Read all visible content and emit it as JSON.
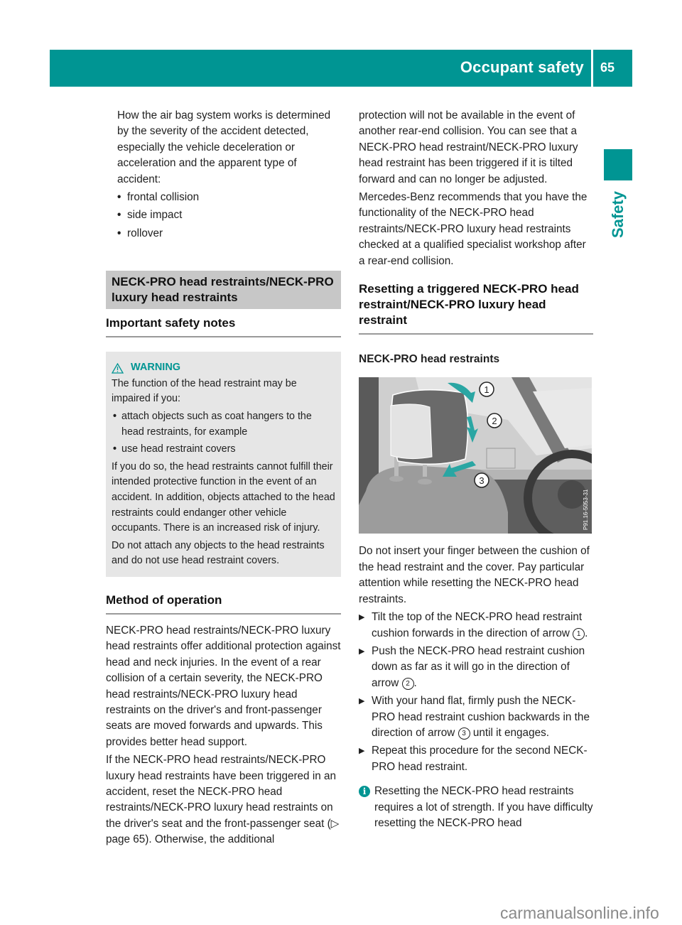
{
  "header": {
    "title": "Occupant safety",
    "page_number": "65",
    "accent_color": "#009593"
  },
  "sidebar": {
    "section_label": "Safety"
  },
  "left_column": {
    "intro": "How the air bag system works is determined by the severity of the accident detected, especially the vehicle deceleration or acceleration and the apparent type of accident:",
    "accident_types": [
      "frontal collision",
      "side impact",
      "rollover"
    ],
    "section_heading": "NECK-PRO head restraints/NECK-PRO luxury head restraints",
    "subsection_heading": "Important safety notes",
    "warning": {
      "label": "WARNING",
      "intro": "The function of the head restraint may be impaired if you:",
      "bullets": [
        "attach objects such as coat hangers to the head restraints, for example",
        "use head restraint covers"
      ],
      "consequence": "If you do so, the head restraints cannot fulfill their intended protective function in the event of an accident. In addition, objects attached to the head restraints could endanger other vehicle occupants. There is an increased risk of injury.",
      "instruction": "Do not attach any objects to the head restraints and do not use head restraint covers."
    },
    "method_heading": "Method of operation",
    "method_p1": "NECK-PRO head restraints/NECK-PRO luxury head restraints offer additional protection against head and neck injuries. In the event of a rear collision of a certain severity, the NECK-PRO head restraints/NECK-PRO luxury head restraints on the driver's and front-passenger seats are moved forwards and upwards. This provides better head support.",
    "method_p2": "If the NECK-PRO head restraints/NECK-PRO luxury head restraints have been triggered in an accident, reset the NECK-PRO head restraints/NECK-PRO luxury head restraints on the driver's seat and the front-passenger seat (▷ page 65). Otherwise, the additional"
  },
  "right_column": {
    "continuation": "protection will not be available in the event of another rear-end collision. You can see that a NECK-PRO head restraint/NECK-PRO luxury head restraint has been triggered if it is tilted forward and can no longer be adjusted.",
    "recommendation": "Mercedes-Benz recommends that you have the functionality of the NECK-PRO head restraints/NECK-PRO luxury head restraints checked at a qualified specialist workshop after a rear-end collision.",
    "reset_heading": "Resetting a triggered NECK-PRO head restraint/NECK-PRO luxury head restraint",
    "neckpro_heading": "NECK-PRO head restraints",
    "figure": {
      "callouts": [
        "1",
        "2",
        "3"
      ],
      "code": "P91.16-5053-31"
    },
    "caution": "Do not insert your finger between the cushion of the head restraint and the cover. Pay particular attention while resetting the NECK-PRO head restraints.",
    "steps": [
      {
        "before": "Tilt the top of the NECK-PRO head restraint cushion forwards in the direction of arrow ",
        "ref": "1",
        "after": "."
      },
      {
        "before": "Push the NECK-PRO head restraint cushion down as far as it will go in the direction of arrow ",
        "ref": "2",
        "after": "."
      },
      {
        "before": "With your hand flat, firmly push the NECK-PRO head restraint cushion backwards in the direction of arrow ",
        "ref": "3",
        "after": " until it engages."
      },
      {
        "before": "Repeat this procedure for the second NECK-PRO head restraint.",
        "ref": null,
        "after": ""
      }
    ],
    "info_note": "Resetting the NECK-PRO head restraints requires a lot of strength. If you have difficulty resetting the NECK-PRO head"
  },
  "watermark": "carmanualsonline.info"
}
